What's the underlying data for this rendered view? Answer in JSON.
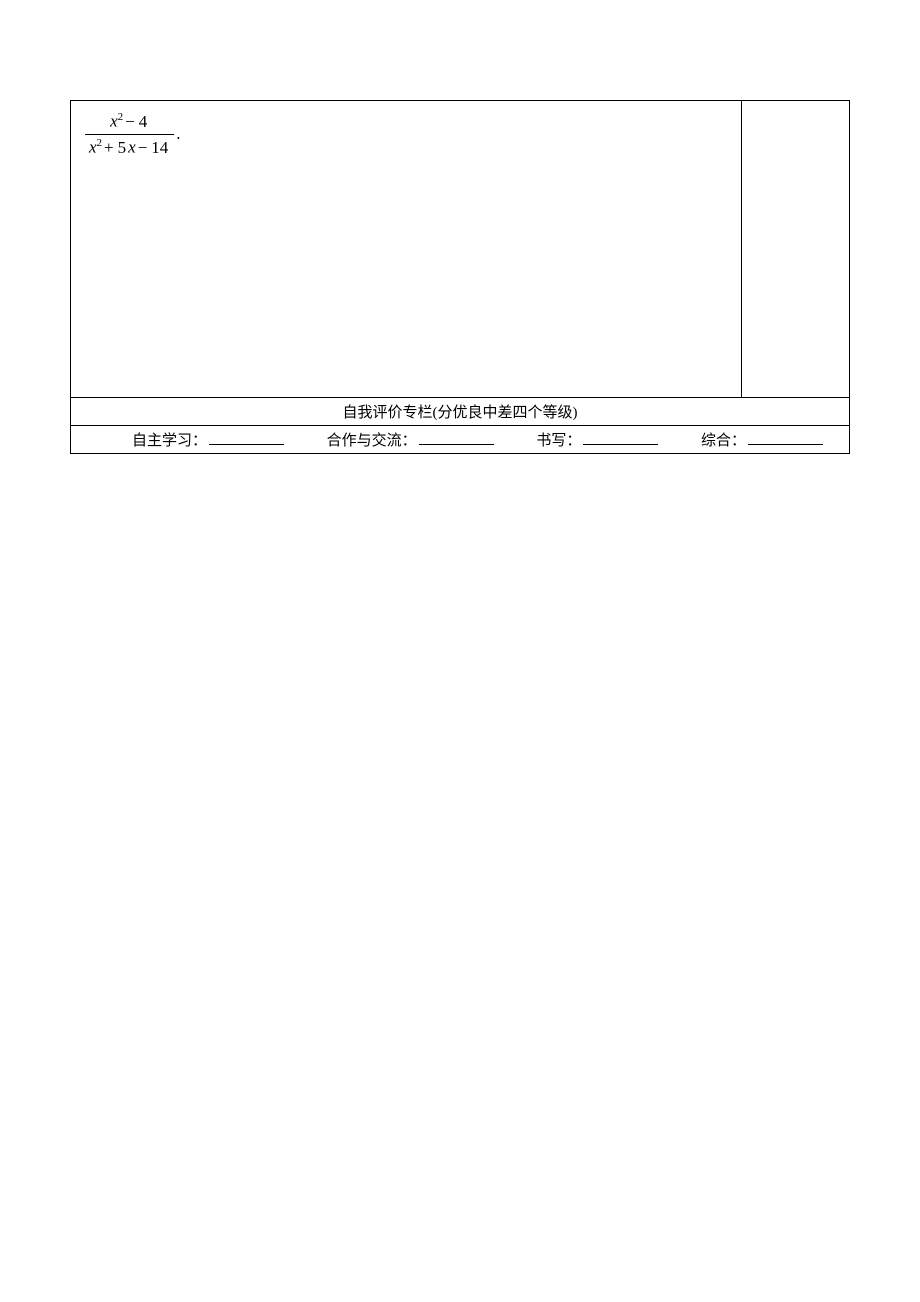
{
  "formula": {
    "numerator": "x² − 4",
    "denominator": "x² + 5x − 14"
  },
  "evalHeader": "自我评价专栏(分优良中差四个等级)",
  "evalItems": {
    "study": "自主学习：",
    "coop": "合作与交流：",
    "writing": "书写：",
    "overall": "综合："
  }
}
